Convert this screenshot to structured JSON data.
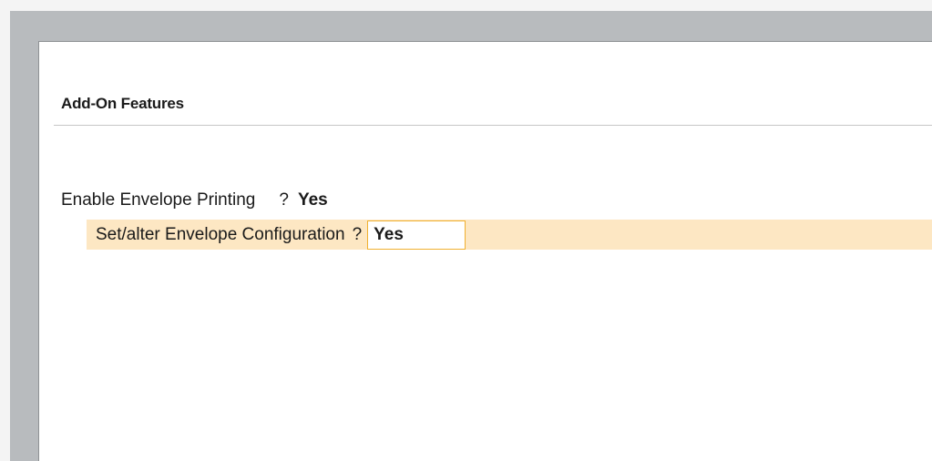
{
  "section": {
    "title": "Add-On Features"
  },
  "fields": {
    "enable_envelope_printing": {
      "label": "Enable Envelope Printing",
      "separator": "?",
      "value": "Yes"
    },
    "set_alter_envelope_configuration": {
      "label": "Set/alter Envelope Configuration",
      "separator": "?",
      "value": "Yes"
    }
  },
  "colors": {
    "frame": "#b8bbbe",
    "panel": "#ffffff",
    "highlight_row": "#fde7c3",
    "active_field_border": "#f0b030"
  }
}
